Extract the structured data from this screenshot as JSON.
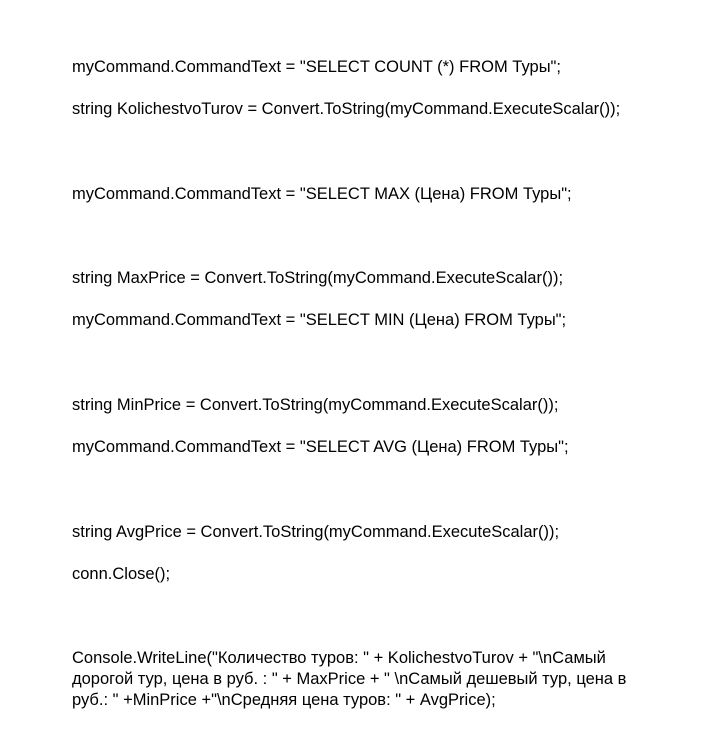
{
  "code": {
    "l1": "myCommand.CommandText = \"SELECT COUNT (*) FROM Туры\";",
    "l2": "string KolichestvoTurov = Convert.ToString(myCommand.ExecuteScalar());",
    "l3": "myCommand.CommandText = \"SELECT MAX (Цена) FROM Туры\";",
    "l4": "string MaxPrice = Convert.ToString(myCommand.ExecuteScalar());",
    "l5": "myCommand.CommandText = \"SELECT MIN (Цена) FROM Туры\";",
    "l6": "string MinPrice = Convert.ToString(myCommand.ExecuteScalar());",
    "l7": "myCommand.CommandText = \"SELECT AVG (Цена) FROM Туры\";",
    "l8": "string AvgPrice = Convert.ToString(myCommand.ExecuteScalar());",
    "l9": "conn.Close();",
    "l10": "Console.WriteLine(\"Количество туров: \" + KolichestvoTurov + \"\\nСамый дорогой тур, цена в руб. : \" + MaxPrice + \" \\nСамый дешевый тур, цена в руб.: \" +MinPrice +\"\\nСредняя цена туров: \" + AvgPrice);"
  }
}
